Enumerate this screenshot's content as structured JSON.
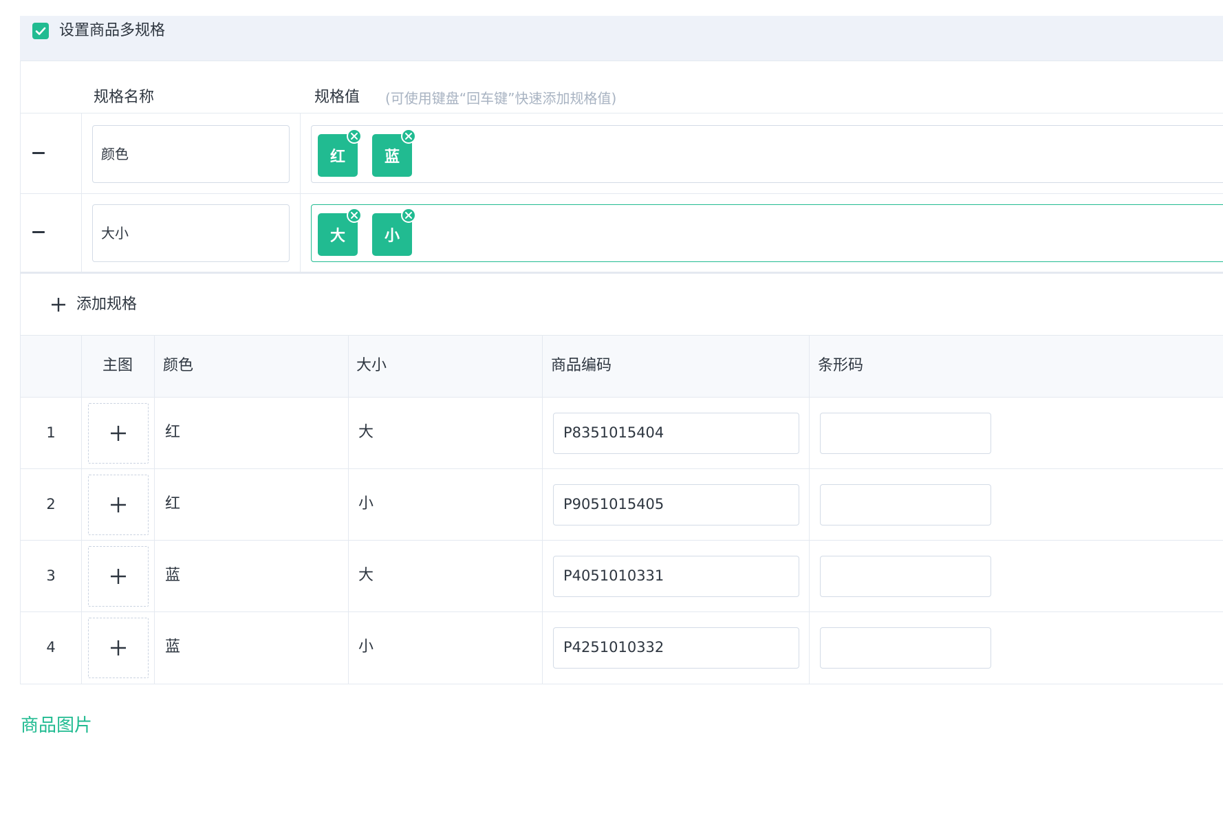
{
  "header": {
    "checkbox_checked": true,
    "label": "设置商品多规格"
  },
  "spec_editor": {
    "col_name": "规格名称",
    "col_values": "规格值",
    "hint": "(可使用键盘“回车键”快速添加规格值)",
    "rows": [
      {
        "name": "颜色",
        "values": [
          "红",
          "蓝"
        ]
      },
      {
        "name": "大小",
        "values": [
          "大",
          "小"
        ]
      }
    ],
    "add_label": "添加规格"
  },
  "sku_table": {
    "headers": {
      "index": "",
      "image": "主图",
      "color": "颜色",
      "size": "大小",
      "code": "商品编码",
      "barcode": "条形码"
    },
    "rows": [
      {
        "index": "1",
        "color": "红",
        "size": "大",
        "code": "P8351015404",
        "barcode": ""
      },
      {
        "index": "2",
        "color": "红",
        "size": "小",
        "code": "P9051015405",
        "barcode": ""
      },
      {
        "index": "3",
        "color": "蓝",
        "size": "大",
        "code": "P4051010331",
        "barcode": ""
      },
      {
        "index": "4",
        "color": "蓝",
        "size": "小",
        "code": "P4251010332",
        "barcode": ""
      }
    ]
  },
  "next_section": {
    "title": "商品图片"
  },
  "colors": {
    "accent": "#21bb91",
    "border": "#d3dbe6",
    "header_bg": "#eef2f9",
    "text": "#2e3640",
    "hint": "#a8b3c2"
  },
  "icons": {
    "checkbox": "checkmark-icon",
    "remove_spec": "minus-icon",
    "remove_value": "close-circle-icon",
    "add": "plus-icon",
    "upload": "plus-icon"
  }
}
